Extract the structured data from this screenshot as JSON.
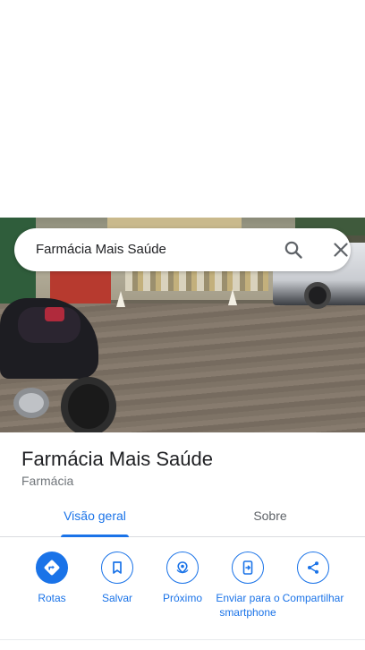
{
  "search": {
    "query": "Farmácia Mais Saúde"
  },
  "place": {
    "name": "Farmácia Mais Saúde",
    "category": "Farmácia"
  },
  "tabs": [
    {
      "label": "Visão geral",
      "active": true
    },
    {
      "label": "Sobre",
      "active": false
    }
  ],
  "actions": [
    {
      "label": "Rotas",
      "icon": "directions-icon"
    },
    {
      "label": "Salvar",
      "icon": "bookmark-icon"
    },
    {
      "label": "Próximo",
      "icon": "nearby-icon"
    },
    {
      "label": "Enviar para o smartphone",
      "icon": "send-to-phone-icon"
    },
    {
      "label": "Compartilhar",
      "icon": "share-icon"
    }
  ],
  "colors": {
    "accent": "#1a73e8",
    "text": "#202124",
    "secondary": "#70757a"
  }
}
